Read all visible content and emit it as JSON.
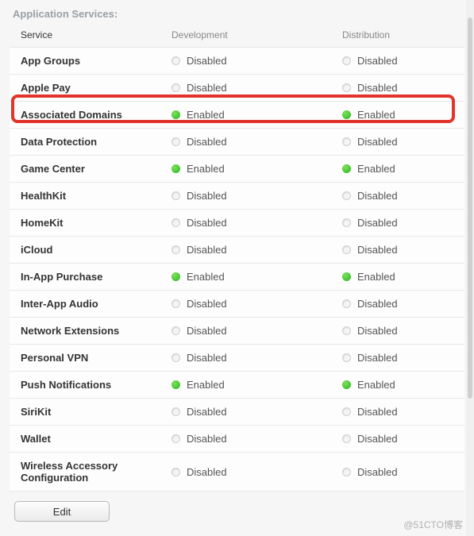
{
  "section_title": "Application Services:",
  "columns": {
    "service": "Service",
    "development": "Development",
    "distribution": "Distribution"
  },
  "status_labels": {
    "enabled": "Enabled",
    "disabled": "Disabled"
  },
  "services": [
    {
      "name": "App Groups",
      "dev": "disabled",
      "dist": "disabled",
      "highlight": false
    },
    {
      "name": "Apple Pay",
      "dev": "disabled",
      "dist": "disabled",
      "highlight": false
    },
    {
      "name": "Associated Domains",
      "dev": "enabled",
      "dist": "enabled",
      "highlight": true
    },
    {
      "name": "Data Protection",
      "dev": "disabled",
      "dist": "disabled",
      "highlight": false
    },
    {
      "name": "Game Center",
      "dev": "enabled",
      "dist": "enabled",
      "highlight": false
    },
    {
      "name": "HealthKit",
      "dev": "disabled",
      "dist": "disabled",
      "highlight": false
    },
    {
      "name": "HomeKit",
      "dev": "disabled",
      "dist": "disabled",
      "highlight": false
    },
    {
      "name": "iCloud",
      "dev": "disabled",
      "dist": "disabled",
      "highlight": false
    },
    {
      "name": "In-App Purchase",
      "dev": "enabled",
      "dist": "enabled",
      "highlight": false
    },
    {
      "name": "Inter-App Audio",
      "dev": "disabled",
      "dist": "disabled",
      "highlight": false
    },
    {
      "name": "Network Extensions",
      "dev": "disabled",
      "dist": "disabled",
      "highlight": false
    },
    {
      "name": "Personal VPN",
      "dev": "disabled",
      "dist": "disabled",
      "highlight": false
    },
    {
      "name": "Push Notifications",
      "dev": "enabled",
      "dist": "enabled",
      "highlight": false
    },
    {
      "name": "SiriKit",
      "dev": "disabled",
      "dist": "disabled",
      "highlight": false
    },
    {
      "name": "Wallet",
      "dev": "disabled",
      "dist": "disabled",
      "highlight": false
    },
    {
      "name": "Wireless Accessory Configuration",
      "dev": "disabled",
      "dist": "disabled",
      "highlight": false
    }
  ],
  "edit_button": "Edit",
  "watermark": "@51CTO博客"
}
